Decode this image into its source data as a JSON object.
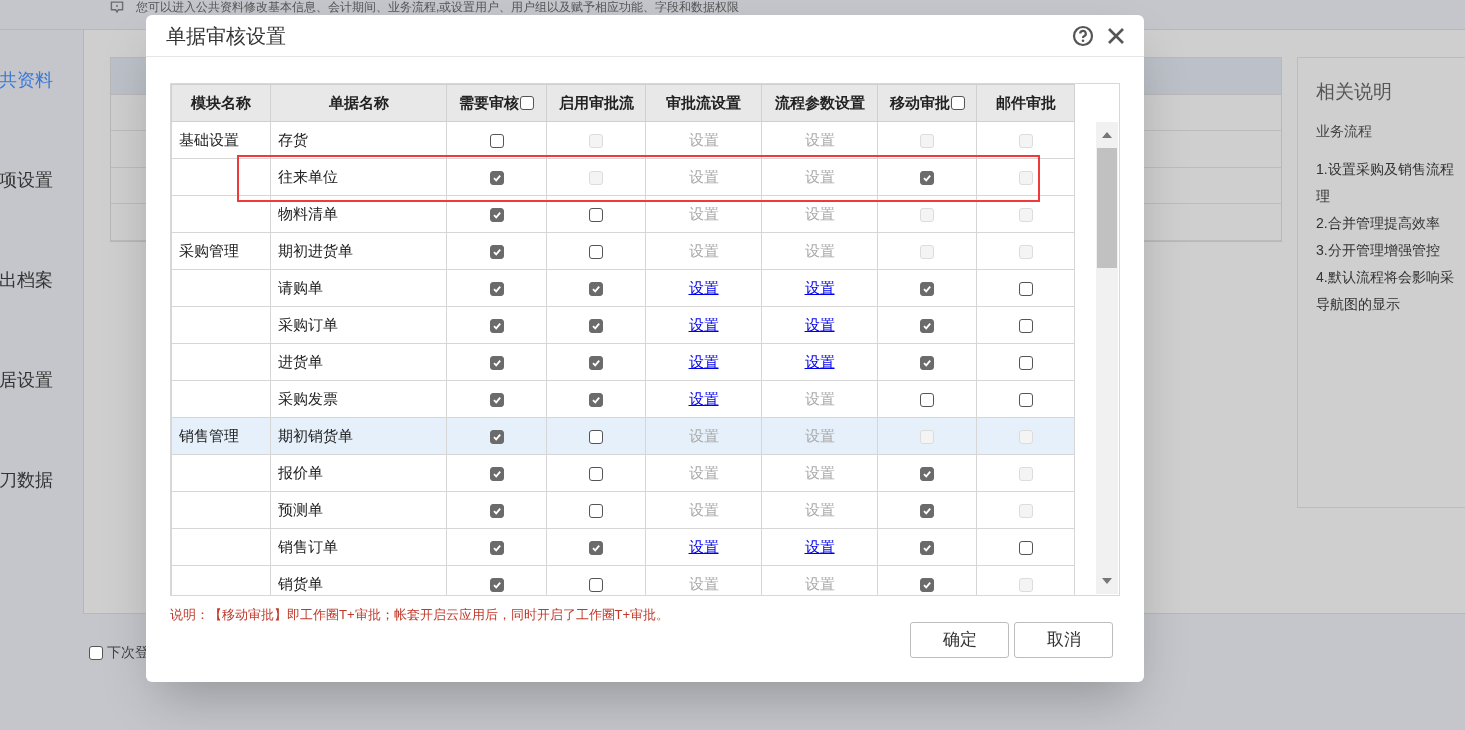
{
  "background": {
    "notice": "您可以进入公共资料修改基本信息、会计期间、业务流程,或设置用户、用户组以及赋予相应功能、字段和数据权限",
    "sidebar_items": [
      {
        "label": "共资料",
        "selected": true
      },
      {
        "label": "项设置",
        "selected": false
      },
      {
        "label": "出档案",
        "selected": false
      },
      {
        "label": "居设置",
        "selected": false
      },
      {
        "label": "刀数据",
        "selected": false
      }
    ],
    "remember": {
      "label": "下次登",
      "checked": false
    },
    "info_panel": {
      "title": "相关说明",
      "subtitle": "业务流程",
      "lines": [
        "1.设置采购及销售流程",
        "理",
        "2.合并管理提高效率",
        "3.分开管理增强管控",
        "4.默认流程将会影响采",
        "导航图的显示"
      ]
    }
  },
  "dialog": {
    "title": "单据审核设置",
    "columns": [
      {
        "label": "模块名称",
        "kind": "text"
      },
      {
        "label": "单据名称",
        "kind": "text"
      },
      {
        "label": "需要审核",
        "kind": "checkbox",
        "checked": false
      },
      {
        "label": "启用审批流",
        "kind": "text"
      },
      {
        "label": "审批流设置",
        "kind": "text"
      },
      {
        "label": "流程参数设置",
        "kind": "text"
      },
      {
        "label": "移动审批",
        "kind": "checkbox",
        "checked": false
      },
      {
        "label": "邮件审批",
        "kind": "text"
      }
    ],
    "rows": [
      {
        "module": "基础设置",
        "name": "存货",
        "selected": false,
        "annotated": false,
        "cells": [
          {
            "kind": "checkbox",
            "checked": false,
            "disabled": false
          },
          {
            "kind": "checkbox",
            "checked": false,
            "disabled": true
          },
          {
            "kind": "link",
            "label": "设置",
            "disabled": true
          },
          {
            "kind": "link",
            "label": "设置",
            "disabled": true
          },
          {
            "kind": "checkbox",
            "checked": false,
            "disabled": true
          },
          {
            "kind": "checkbox",
            "checked": false,
            "disabled": true
          }
        ]
      },
      {
        "name": "往来单位",
        "selected": false,
        "annotated": true,
        "cells": [
          {
            "kind": "checkbox",
            "checked": true,
            "disabled": false
          },
          {
            "kind": "checkbox",
            "checked": false,
            "disabled": true
          },
          {
            "kind": "link",
            "label": "设置",
            "disabled": true
          },
          {
            "kind": "link",
            "label": "设置",
            "disabled": true
          },
          {
            "kind": "checkbox",
            "checked": true,
            "disabled": false
          },
          {
            "kind": "checkbox",
            "checked": false,
            "disabled": true
          }
        ]
      },
      {
        "name": "物料清单",
        "selected": false,
        "annotated": false,
        "cells": [
          {
            "kind": "checkbox",
            "checked": true,
            "disabled": false
          },
          {
            "kind": "checkbox",
            "checked": false,
            "disabled": false
          },
          {
            "kind": "link",
            "label": "设置",
            "disabled": true
          },
          {
            "kind": "link",
            "label": "设置",
            "disabled": true
          },
          {
            "kind": "checkbox",
            "checked": false,
            "disabled": true
          },
          {
            "kind": "checkbox",
            "checked": false,
            "disabled": true
          }
        ]
      },
      {
        "module": "采购管理",
        "name": "期初进货单",
        "selected": false,
        "annotated": false,
        "cells": [
          {
            "kind": "checkbox",
            "checked": true,
            "disabled": false
          },
          {
            "kind": "checkbox",
            "checked": false,
            "disabled": false
          },
          {
            "kind": "link",
            "label": "设置",
            "disabled": true
          },
          {
            "kind": "link",
            "label": "设置",
            "disabled": true
          },
          {
            "kind": "checkbox",
            "checked": false,
            "disabled": true
          },
          {
            "kind": "checkbox",
            "checked": false,
            "disabled": true
          }
        ]
      },
      {
        "name": "请购单",
        "selected": false,
        "annotated": false,
        "cells": [
          {
            "kind": "checkbox",
            "checked": true,
            "disabled": false
          },
          {
            "kind": "checkbox",
            "checked": true,
            "disabled": false
          },
          {
            "kind": "link",
            "label": "设置",
            "disabled": false
          },
          {
            "kind": "link",
            "label": "设置",
            "disabled": false
          },
          {
            "kind": "checkbox",
            "checked": true,
            "disabled": false
          },
          {
            "kind": "checkbox",
            "checked": false,
            "disabled": false
          }
        ]
      },
      {
        "name": "采购订单",
        "selected": false,
        "annotated": false,
        "cells": [
          {
            "kind": "checkbox",
            "checked": true,
            "disabled": false
          },
          {
            "kind": "checkbox",
            "checked": true,
            "disabled": false
          },
          {
            "kind": "link",
            "label": "设置",
            "disabled": false
          },
          {
            "kind": "link",
            "label": "设置",
            "disabled": false
          },
          {
            "kind": "checkbox",
            "checked": true,
            "disabled": false
          },
          {
            "kind": "checkbox",
            "checked": false,
            "disabled": false
          }
        ]
      },
      {
        "name": "进货单",
        "selected": false,
        "annotated": false,
        "cells": [
          {
            "kind": "checkbox",
            "checked": true,
            "disabled": false
          },
          {
            "kind": "checkbox",
            "checked": true,
            "disabled": false
          },
          {
            "kind": "link",
            "label": "设置",
            "disabled": false
          },
          {
            "kind": "link",
            "label": "设置",
            "disabled": false
          },
          {
            "kind": "checkbox",
            "checked": true,
            "disabled": false
          },
          {
            "kind": "checkbox",
            "checked": false,
            "disabled": false
          }
        ]
      },
      {
        "name": "采购发票",
        "selected": false,
        "annotated": false,
        "cells": [
          {
            "kind": "checkbox",
            "checked": true,
            "disabled": false
          },
          {
            "kind": "checkbox",
            "checked": true,
            "disabled": false
          },
          {
            "kind": "link",
            "label": "设置",
            "disabled": false
          },
          {
            "kind": "link",
            "label": "设置",
            "disabled": true
          },
          {
            "kind": "checkbox",
            "checked": false,
            "disabled": false
          },
          {
            "kind": "checkbox",
            "checked": false,
            "disabled": false
          }
        ]
      },
      {
        "module": "销售管理",
        "name": "期初销货单",
        "selected": true,
        "annotated": false,
        "cells": [
          {
            "kind": "checkbox",
            "checked": true,
            "disabled": false
          },
          {
            "kind": "checkbox",
            "checked": false,
            "disabled": false
          },
          {
            "kind": "link",
            "label": "设置",
            "disabled": true
          },
          {
            "kind": "link",
            "label": "设置",
            "disabled": true
          },
          {
            "kind": "checkbox",
            "checked": false,
            "disabled": true
          },
          {
            "kind": "checkbox",
            "checked": false,
            "disabled": true
          }
        ]
      },
      {
        "name": "报价单",
        "selected": false,
        "annotated": false,
        "cells": [
          {
            "kind": "checkbox",
            "checked": true,
            "disabled": false
          },
          {
            "kind": "checkbox",
            "checked": false,
            "disabled": false
          },
          {
            "kind": "link",
            "label": "设置",
            "disabled": true
          },
          {
            "kind": "link",
            "label": "设置",
            "disabled": true
          },
          {
            "kind": "checkbox",
            "checked": true,
            "disabled": false
          },
          {
            "kind": "checkbox",
            "checked": false,
            "disabled": true
          }
        ]
      },
      {
        "name": "预测单",
        "selected": false,
        "annotated": false,
        "cells": [
          {
            "kind": "checkbox",
            "checked": true,
            "disabled": false
          },
          {
            "kind": "checkbox",
            "checked": false,
            "disabled": false
          },
          {
            "kind": "link",
            "label": "设置",
            "disabled": true
          },
          {
            "kind": "link",
            "label": "设置",
            "disabled": true
          },
          {
            "kind": "checkbox",
            "checked": true,
            "disabled": false
          },
          {
            "kind": "checkbox",
            "checked": false,
            "disabled": true
          }
        ]
      },
      {
        "name": "销售订单",
        "selected": false,
        "annotated": false,
        "cells": [
          {
            "kind": "checkbox",
            "checked": true,
            "disabled": false
          },
          {
            "kind": "checkbox",
            "checked": true,
            "disabled": false
          },
          {
            "kind": "link",
            "label": "设置",
            "disabled": false
          },
          {
            "kind": "link",
            "label": "设置",
            "disabled": false
          },
          {
            "kind": "checkbox",
            "checked": true,
            "disabled": false
          },
          {
            "kind": "checkbox",
            "checked": false,
            "disabled": false
          }
        ]
      },
      {
        "name": "销货单",
        "selected": false,
        "annotated": false,
        "cells": [
          {
            "kind": "checkbox",
            "checked": true,
            "disabled": false
          },
          {
            "kind": "checkbox",
            "checked": false,
            "disabled": false
          },
          {
            "kind": "link",
            "label": "设置",
            "disabled": true
          },
          {
            "kind": "link",
            "label": "设置",
            "disabled": true
          },
          {
            "kind": "checkbox",
            "checked": true,
            "disabled": false
          },
          {
            "kind": "checkbox",
            "checked": false,
            "disabled": true
          }
        ]
      }
    ],
    "note": "说明：【移动审批】即工作圈T+审批；帐套开启云应用后，同时开启了工作圈T+审批。",
    "buttons": [
      "确定",
      "取消"
    ]
  }
}
